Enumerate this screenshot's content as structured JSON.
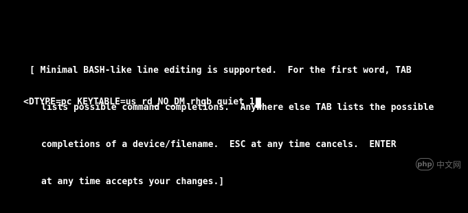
{
  "help_text": {
    "lines": [
      "[ Minimal BASH-like line editing is supported.  For the first word, TAB",
      "lists possible command completions.  Anywhere else TAB lists the possible",
      "completions of a device/filename.  ESC at any time cancels.  ENTER",
      "at any time accepts your changes.]"
    ]
  },
  "command_line": {
    "value": "<DTYPE=pc KEYTABLE=us rd_NO_DM rhgb quiet 1"
  },
  "watermark": {
    "logo": "php",
    "text": "中文网"
  },
  "colors": {
    "background": "#000000",
    "text": "#ffffff"
  }
}
